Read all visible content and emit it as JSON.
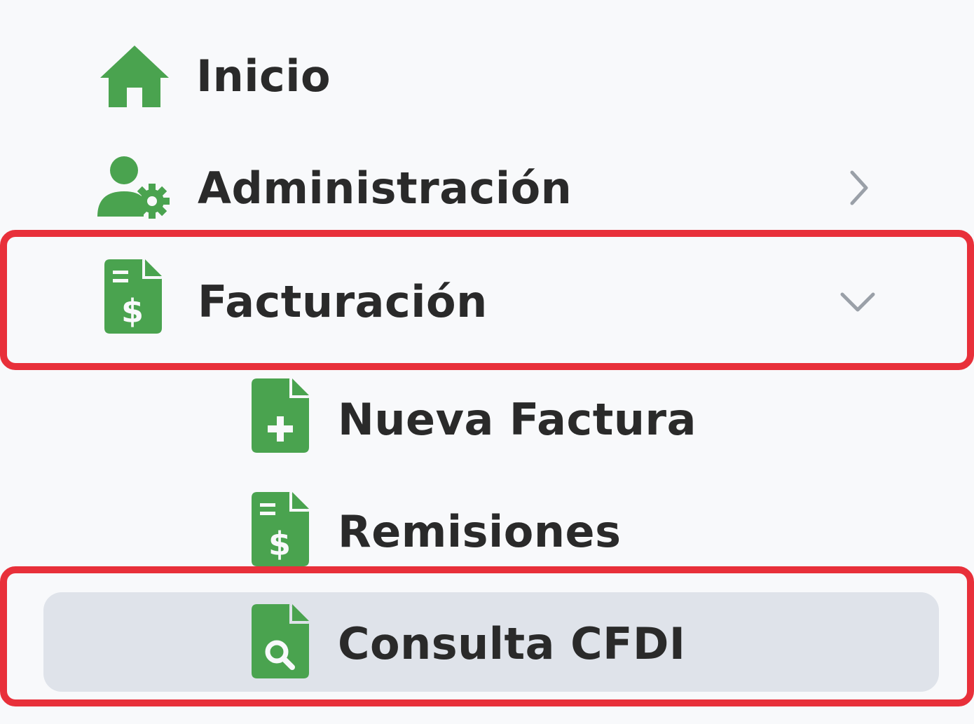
{
  "colors": {
    "icon_green": "#4aa34f",
    "text": "#2a2a2a",
    "active_bg": "#dfe3ea",
    "highlight_red": "#e8303a",
    "background": "#f8f9fb",
    "chevron": "#9aa0a8"
  },
  "menu": {
    "items": [
      {
        "label": "Inicio",
        "icon": "home-icon"
      },
      {
        "label": "Administración",
        "icon": "user-gear-icon",
        "chevron": "chevron-right-icon"
      },
      {
        "label": "Facturación",
        "icon": "invoice-dollar-icon",
        "chevron": "chevron-down-icon",
        "expanded": true
      },
      {
        "label": "Nueva Factura",
        "icon": "file-plus-icon"
      },
      {
        "label": "Remisiones",
        "icon": "invoice-dollar-icon"
      },
      {
        "label": "Consulta CFDI",
        "icon": "file-search-icon",
        "active": true
      }
    ]
  }
}
